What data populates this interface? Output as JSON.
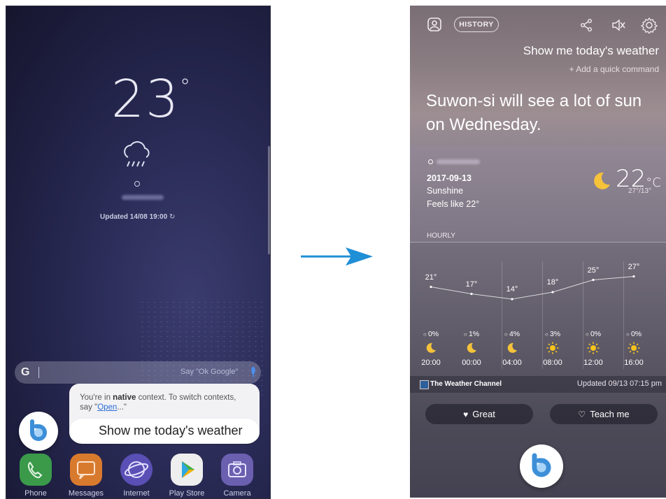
{
  "left_screen": {
    "temperature": "23",
    "degree_symbol": "°",
    "updated": "Updated 14/08 19:00",
    "search": {
      "g_logo": "G",
      "hint": "Say \"Ok Google\""
    },
    "bixby": {
      "context_prefix": "You're in ",
      "context_bold": "native",
      "context_mid": " context. To switch contexts, say \"",
      "context_link": "Open",
      "context_suffix": "...\"",
      "command": "Show me today's weather"
    },
    "dock": [
      {
        "label": "Phone",
        "icon": "phone-icon",
        "color": "#3a9a4a"
      },
      {
        "label": "Messages",
        "icon": "messages-icon",
        "color": "#e07a2a"
      },
      {
        "label": "Internet",
        "icon": "internet-icon",
        "color": "#5a4fb5"
      },
      {
        "label": "Play Store",
        "icon": "play-store-icon",
        "color": "#eeeeee"
      },
      {
        "label": "Camera",
        "icon": "camera-icon",
        "color": "#6b5fb0"
      }
    ]
  },
  "right_screen": {
    "history": "HISTORY",
    "query": "Show me today's weather",
    "quick_command": "+ Add a quick command",
    "answer": "Suwon-si will see a lot of sun on Wednesday.",
    "card": {
      "date": "2017-09-13",
      "condition": "Sunshine",
      "feels_like": "Feels like 22°",
      "temperature": "22",
      "unit": "°C",
      "range": "27°/13°",
      "hourly_label": "HOURLY"
    },
    "hourly": [
      {
        "temp": "21°",
        "rain": "0%",
        "icon": "moon-icon",
        "time": "20:00"
      },
      {
        "temp": "17°",
        "rain": "1%",
        "icon": "moon-icon",
        "time": "00:00"
      },
      {
        "temp": "14°",
        "rain": "4%",
        "icon": "moon-icon",
        "time": "04:00"
      },
      {
        "temp": "18°",
        "rain": "3%",
        "icon": "sun-icon",
        "time": "08:00"
      },
      {
        "temp": "25°",
        "rain": "0%",
        "icon": "sun-icon",
        "time": "12:00"
      },
      {
        "temp": "27°",
        "rain": "0%",
        "icon": "sun-icon",
        "time": "16:00"
      }
    ],
    "source": "The Weather Channel",
    "updated": "Updated 09/13 07:15 pm",
    "feedback": {
      "great": "Great",
      "teach": "Teach me"
    },
    "colors": {
      "moon": "#f5c23a",
      "sun": "#f7c21c",
      "bixby_blue": "#3d8fd8"
    }
  }
}
